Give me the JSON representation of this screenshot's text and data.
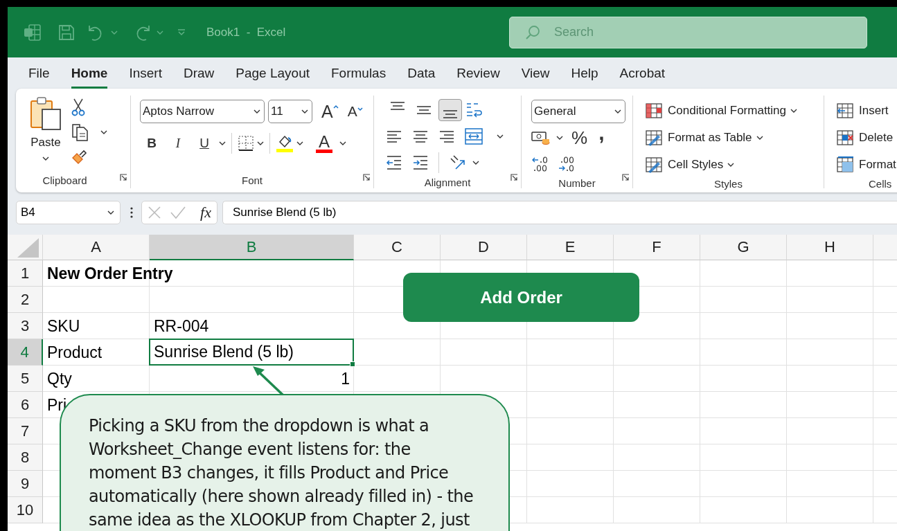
{
  "title_bar": {
    "title": "Book1  -  Excel",
    "search": {
      "placeholder": "Search"
    }
  },
  "tabs": [
    {
      "label": "File",
      "selected": false
    },
    {
      "label": "Home",
      "selected": true
    },
    {
      "label": "Insert",
      "selected": false
    },
    {
      "label": "Draw",
      "selected": false
    },
    {
      "label": "Page Layout",
      "selected": false
    },
    {
      "label": "Formulas",
      "selected": false
    },
    {
      "label": "Data",
      "selected": false
    },
    {
      "label": "Review",
      "selected": false
    },
    {
      "label": "View",
      "selected": false
    },
    {
      "label": "Help",
      "selected": false
    },
    {
      "label": "Acrobat",
      "selected": false
    }
  ],
  "ribbon": {
    "clipboard": {
      "label": "Clipboard",
      "paste": "Paste"
    },
    "font": {
      "label": "Font",
      "font_name": "Aptos Narrow",
      "font_size": "11",
      "grow": "A",
      "shrink": "A",
      "bold": "B",
      "italic": "I",
      "underline": "U",
      "font_color": "A"
    },
    "alignment": {
      "label": "Alignment",
      "vertical": [
        {
          "selected": false
        },
        {
          "selected": false
        },
        {
          "selected": true
        }
      ]
    },
    "number": {
      "label": "Number",
      "format": "General",
      "percent": "%",
      "comma": ","
    },
    "styles": {
      "label": "Styles",
      "items": [
        "Conditional Formatting",
        "Format as Table",
        "Cell Styles"
      ]
    },
    "cells": {
      "label": "Cells",
      "items": [
        "Insert",
        "Delete",
        "Format"
      ]
    }
  },
  "formula_bar": {
    "name_box": "B4",
    "function_label": "fx",
    "value": "Sunrise Blend (5 lb)"
  },
  "sheet": {
    "columns": [
      {
        "label": "A",
        "selected": false
      },
      {
        "label": "B",
        "selected": true
      },
      {
        "label": "C",
        "selected": false
      },
      {
        "label": "D",
        "selected": false
      },
      {
        "label": "E",
        "selected": false
      },
      {
        "label": "F",
        "selected": false
      },
      {
        "label": "G",
        "selected": false
      },
      {
        "label": "H",
        "selected": false
      }
    ],
    "rows": [
      {
        "number": "1",
        "selected": false,
        "a": {
          "text": "New Order Entry",
          "bold": true,
          "kind": "text",
          "selected": false
        }
      },
      {
        "number": "2",
        "selected": false
      },
      {
        "number": "3",
        "selected": false,
        "a": {
          "text": "SKU",
          "bold": false,
          "kind": "text",
          "selected": false
        },
        "b": {
          "text": "RR-004",
          "bold": false,
          "kind": "text",
          "selected": false
        }
      },
      {
        "number": "4",
        "selected": true,
        "a": {
          "text": "Product",
          "bold": false,
          "kind": "text",
          "selected": false
        },
        "b": {
          "text": "Sunrise Blend (5 lb)",
          "bold": false,
          "kind": "text",
          "selected": true
        }
      },
      {
        "number": "5",
        "selected": false,
        "a": {
          "text": "Qty",
          "bold": false,
          "kind": "text",
          "selected": false
        },
        "b": {
          "text": "1",
          "bold": false,
          "kind": "number",
          "selected": false
        }
      },
      {
        "number": "6",
        "selected": false,
        "a": {
          "text": "Pri",
          "bold": false,
          "kind": "text",
          "selected": false
        }
      },
      {
        "number": "7",
        "selected": false
      },
      {
        "number": "8",
        "selected": false
      },
      {
        "number": "9",
        "selected": false
      },
      {
        "number": "10",
        "selected": false
      }
    ]
  },
  "button": {
    "label": "Add Order"
  },
  "callout": {
    "text": "Picking a SKU from the dropdown is what a Worksheet_Change event listens for: the moment B3 changes, it fills Product and Price automatically (here shown already filled in) - the same idea as the XLOOKUP from Chapter 2, just"
  }
}
